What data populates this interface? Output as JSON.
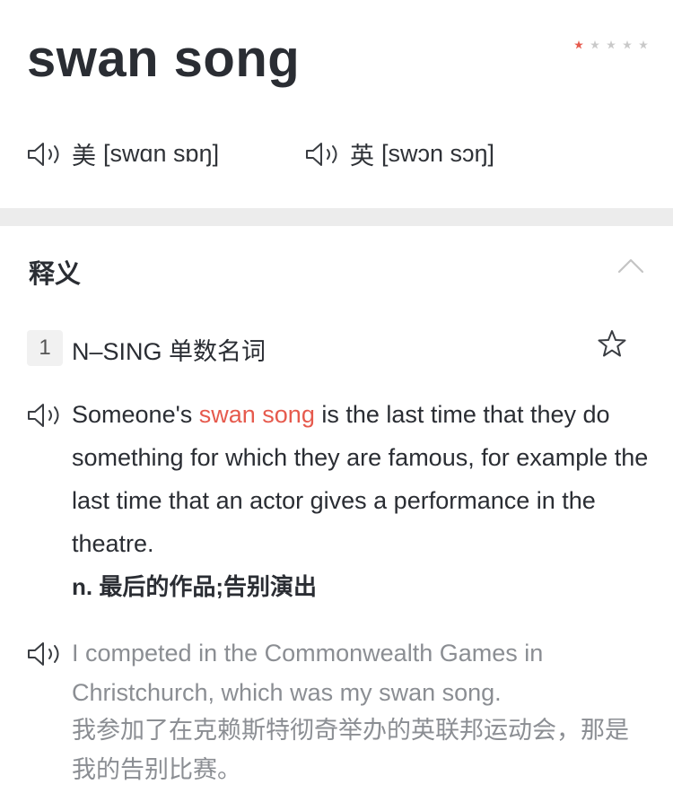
{
  "entry": {
    "word": "swan song",
    "rating": {
      "filled": 1,
      "total": 5,
      "filled_color": "#e65a4d",
      "empty_color": "#c9c9c9"
    }
  },
  "pronunciations": {
    "us": {
      "label": "美",
      "ipa": "[swɑn sɒŋ]",
      "icon": "speaker-icon"
    },
    "uk": {
      "label": "英",
      "ipa": "[swɔn sɔŋ]",
      "icon": "speaker-icon"
    }
  },
  "definitions_section": {
    "title": "释义",
    "collapse_icon": "chevron-up-icon"
  },
  "senses": [
    {
      "number": "1",
      "pos": "N–SING 单数名词",
      "favorite_icon": "star-outline-icon",
      "definition": {
        "prefix": "Someone's ",
        "highlight": "swan song",
        "suffix": " is the last time that they do something for which they are famous, for example the last time that an actor gives a performance in the theatre.",
        "translation": "n. 最后的作品;告别演出"
      },
      "example": {
        "en": "I competed in the Commonwealth Games in Christchurch, which was my swan song.",
        "cn": "我参加了在克赖斯特彻奇举办的英联邦运动会，那是我的告别比赛。"
      }
    }
  ],
  "colors": {
    "accent": "#e65a4d",
    "text": "#2a2d33",
    "muted": "#8b8e93",
    "divider": "#ececec"
  }
}
